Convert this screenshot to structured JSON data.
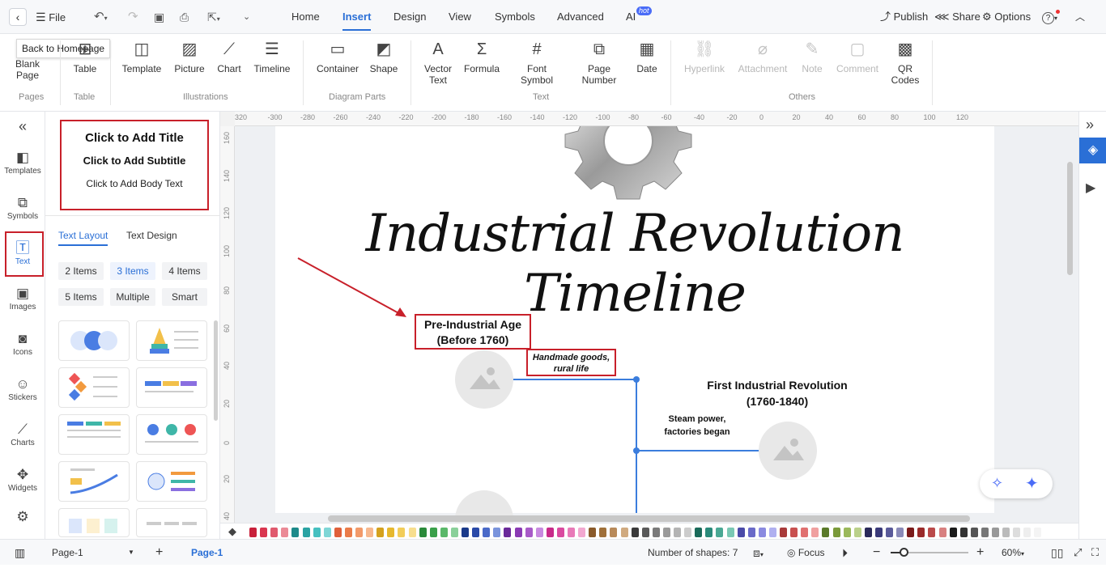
{
  "topbar": {
    "file_label": "File",
    "tabs": [
      "Home",
      "Insert",
      "Design",
      "View",
      "Symbols",
      "Advanced",
      "AI"
    ],
    "ai_badge": "hot",
    "publish": "Publish",
    "share": "Share",
    "options": "Options",
    "help": "?"
  },
  "tooltip": "Back to Homepage",
  "ribbon": {
    "pages": {
      "blank_page": "Blank Page",
      "group": "Pages"
    },
    "table": {
      "table": "Table",
      "group": "Table"
    },
    "illustrations": {
      "template": "Template",
      "picture": "Picture",
      "chart": "Chart",
      "timeline": "Timeline",
      "group": "Illustrations"
    },
    "diagram_parts": {
      "container": "Container",
      "shape": "Shape",
      "group": "Diagram Parts"
    },
    "text": {
      "vector_text": "Vector Text",
      "formula": "Formula",
      "font_symbol": "Font Symbol",
      "page_number": "Page Number",
      "date": "Date",
      "group": "Text"
    },
    "others": {
      "hyperlink": "Hyperlink",
      "attachment": "Attachment",
      "note": "Note",
      "comment": "Comment",
      "qr_codes": "QR Codes",
      "group": "Others"
    }
  },
  "leftbar": [
    "Templates",
    "Symbols",
    "Text",
    "Images",
    "Icons",
    "Stickers",
    "Charts",
    "Widgets"
  ],
  "panel": {
    "title": "Click to Add Title",
    "subtitle": "Click to Add Subtitle",
    "body": "Click to Add Body Text",
    "tabs": [
      "Text Layout",
      "Text Design"
    ],
    "chips": [
      "2 Items",
      "3 Items",
      "4 Items",
      "5 Items",
      "Multiple",
      "Smart"
    ]
  },
  "rulers": {
    "h": [
      "320",
      "-300",
      "-280",
      "-260",
      "-240",
      "-220",
      "-200",
      "-180",
      "-160",
      "-140",
      "-120",
      "-100",
      "-80",
      "-60",
      "-40",
      "-20",
      "0",
      "20",
      "40",
      "60",
      "80",
      "100",
      "120"
    ],
    "v": [
      "160",
      "140",
      "120",
      "100",
      "80",
      "60",
      "40",
      "20",
      "0",
      "20",
      "40"
    ]
  },
  "diagram": {
    "title": "Industrial Revolution Timeline",
    "pre_title": "Pre-Industrial Age",
    "pre_date": "(Before 1760)",
    "pre_desc_1": "Handmade goods,",
    "pre_desc_2": "rural life",
    "first_title": "First Industrial Revolution",
    "first_date": "(1760-1840)",
    "first_desc_1": "Steam power,",
    "first_desc_2": "factories began"
  },
  "statusbar": {
    "page_select": "Page-1",
    "page_tab": "Page-1",
    "shapes": "Number of shapes: 7",
    "focus": "Focus",
    "zoom": "60%"
  },
  "colors": {
    "accent": "#2a6fd6",
    "highlight": "#c8202a",
    "connector": "#3b7ddd"
  }
}
